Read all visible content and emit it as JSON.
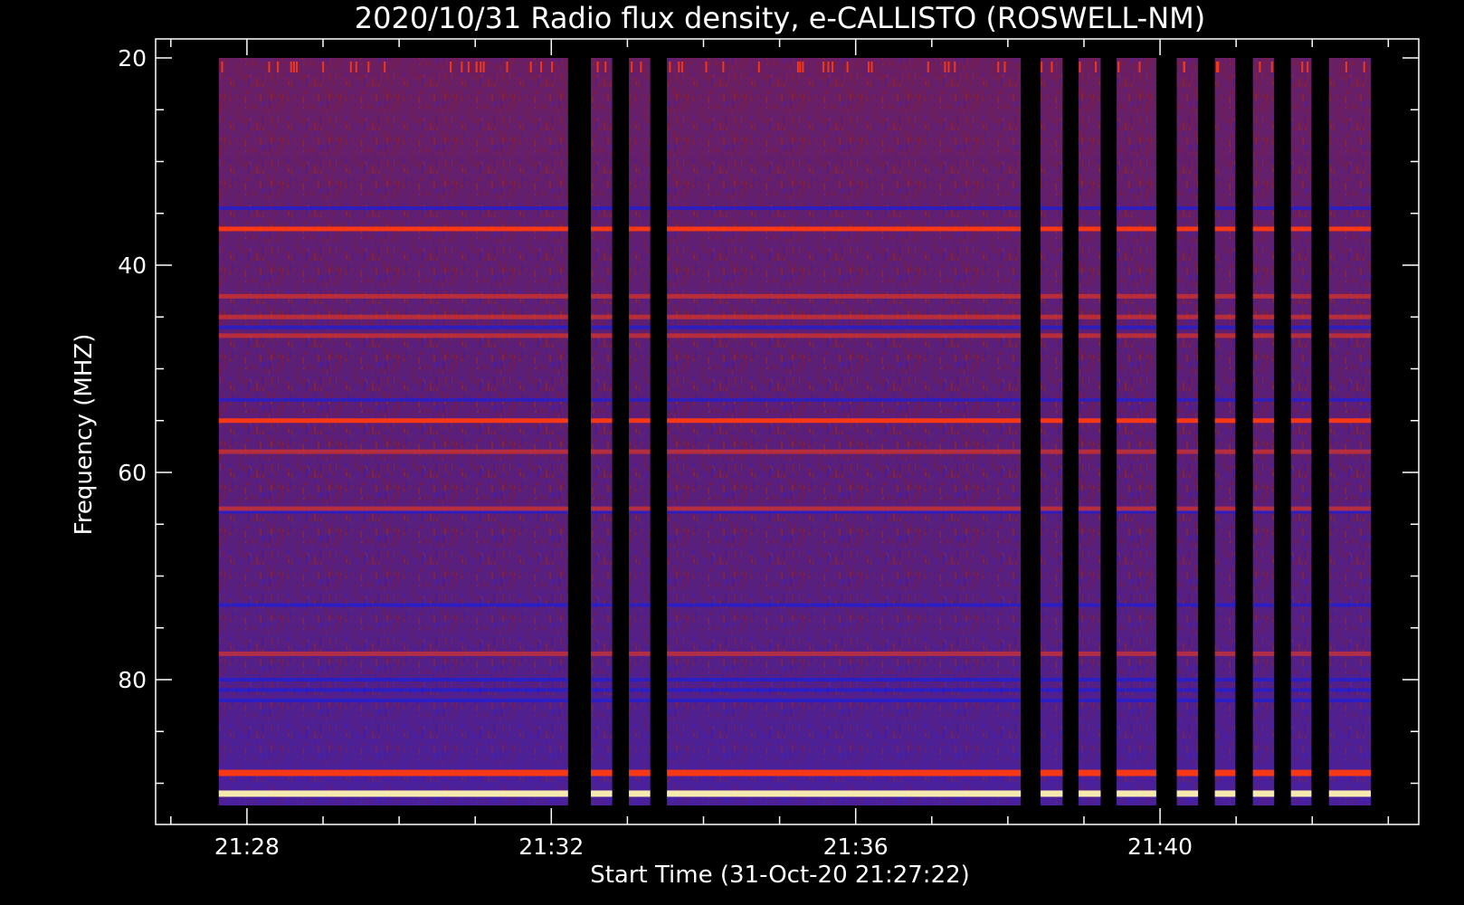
{
  "chart_data": {
    "type": "heatmap",
    "title": "2020/10/31  Radio flux density, e-CALLISTO (ROSWELL-NM)",
    "xlabel": "Start Time (31-Oct-20 21:27:22)",
    "ylabel": "Frequency (MHZ)",
    "x_ticks": [
      "21:28",
      "21:32",
      "21:36",
      "21:40"
    ],
    "x_tick_minutes": [
      28,
      32,
      36,
      40
    ],
    "y_ticks": [
      "20",
      "40",
      "60",
      "80"
    ],
    "y_tick_values": [
      20,
      40,
      60,
      80
    ],
    "ylim": [
      92.5,
      18.2
    ],
    "xlim_minutes": [
      26.8,
      43.4
    ],
    "y_reversed": true,
    "grid": false,
    "colormap": "red-temperature",
    "data_segments_minutes": [
      [
        27.63,
        32.22
      ],
      [
        32.52,
        32.8
      ],
      [
        33.02,
        33.3
      ],
      [
        33.52,
        38.17
      ],
      [
        38.43,
        38.72
      ],
      [
        38.93,
        39.22
      ],
      [
        39.43,
        39.95
      ],
      [
        40.22,
        40.5
      ],
      [
        40.72,
        40.99
      ],
      [
        41.22,
        41.5
      ],
      [
        41.72,
        41.99
      ],
      [
        42.22,
        42.77
      ]
    ],
    "intense_band_frequencies_mhz": [
      36.5,
      43.0,
      45.0,
      46.8,
      55.0,
      58.0,
      63.5,
      77.5,
      89.0,
      91.0
    ],
    "quiet_band_frequencies_mhz": [
      34.5,
      46.0,
      53.0,
      63.8,
      72.8,
      80.0,
      81.0,
      82.0
    ],
    "colors": {
      "background": "#000000",
      "axis": "#ffffff",
      "text": "#ffffff",
      "base_signal": "#5a1f7a",
      "low": "#1d1fd8",
      "high": "#ff3a10",
      "peak": "#fff4b0"
    }
  }
}
